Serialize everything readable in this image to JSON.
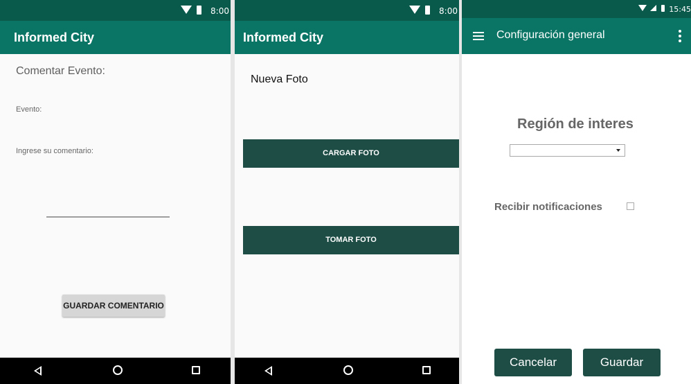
{
  "screen1": {
    "status_time": "8:00",
    "app_title": "Informed City",
    "heading": "Comentar Evento:",
    "event_label": "Evento:",
    "comment_label": "Ingrese su comentario:",
    "save_button": "GUARDAR COMENTARIO"
  },
  "screen2": {
    "status_time": "8:00",
    "app_title": "Informed City",
    "heading": "Nueva Foto",
    "upload_button": "CARGAR FOTO",
    "take_button": "TOMAR FOTO"
  },
  "screen3": {
    "status_time": "15:45",
    "app_title": "Configuración general",
    "region_label": "Región de interes",
    "region_selected": "",
    "notifications_label": "Recibir notificaciones",
    "notifications_checked": false,
    "cancel_button": "Cancelar",
    "save_button": "Guardar"
  },
  "icons": [
    "wifi-icon",
    "battery-icon",
    "nav-back-icon",
    "nav-home-icon",
    "nav-recents-icon",
    "menu-icon",
    "more-vert-icon",
    "signal-icon"
  ],
  "colors": {
    "status_bar": "#0a5a4c",
    "app_bar": "#0b7565",
    "dark_button": "#1e4d46",
    "gray_button": "#d6d6d6",
    "background": "#fafafa"
  }
}
